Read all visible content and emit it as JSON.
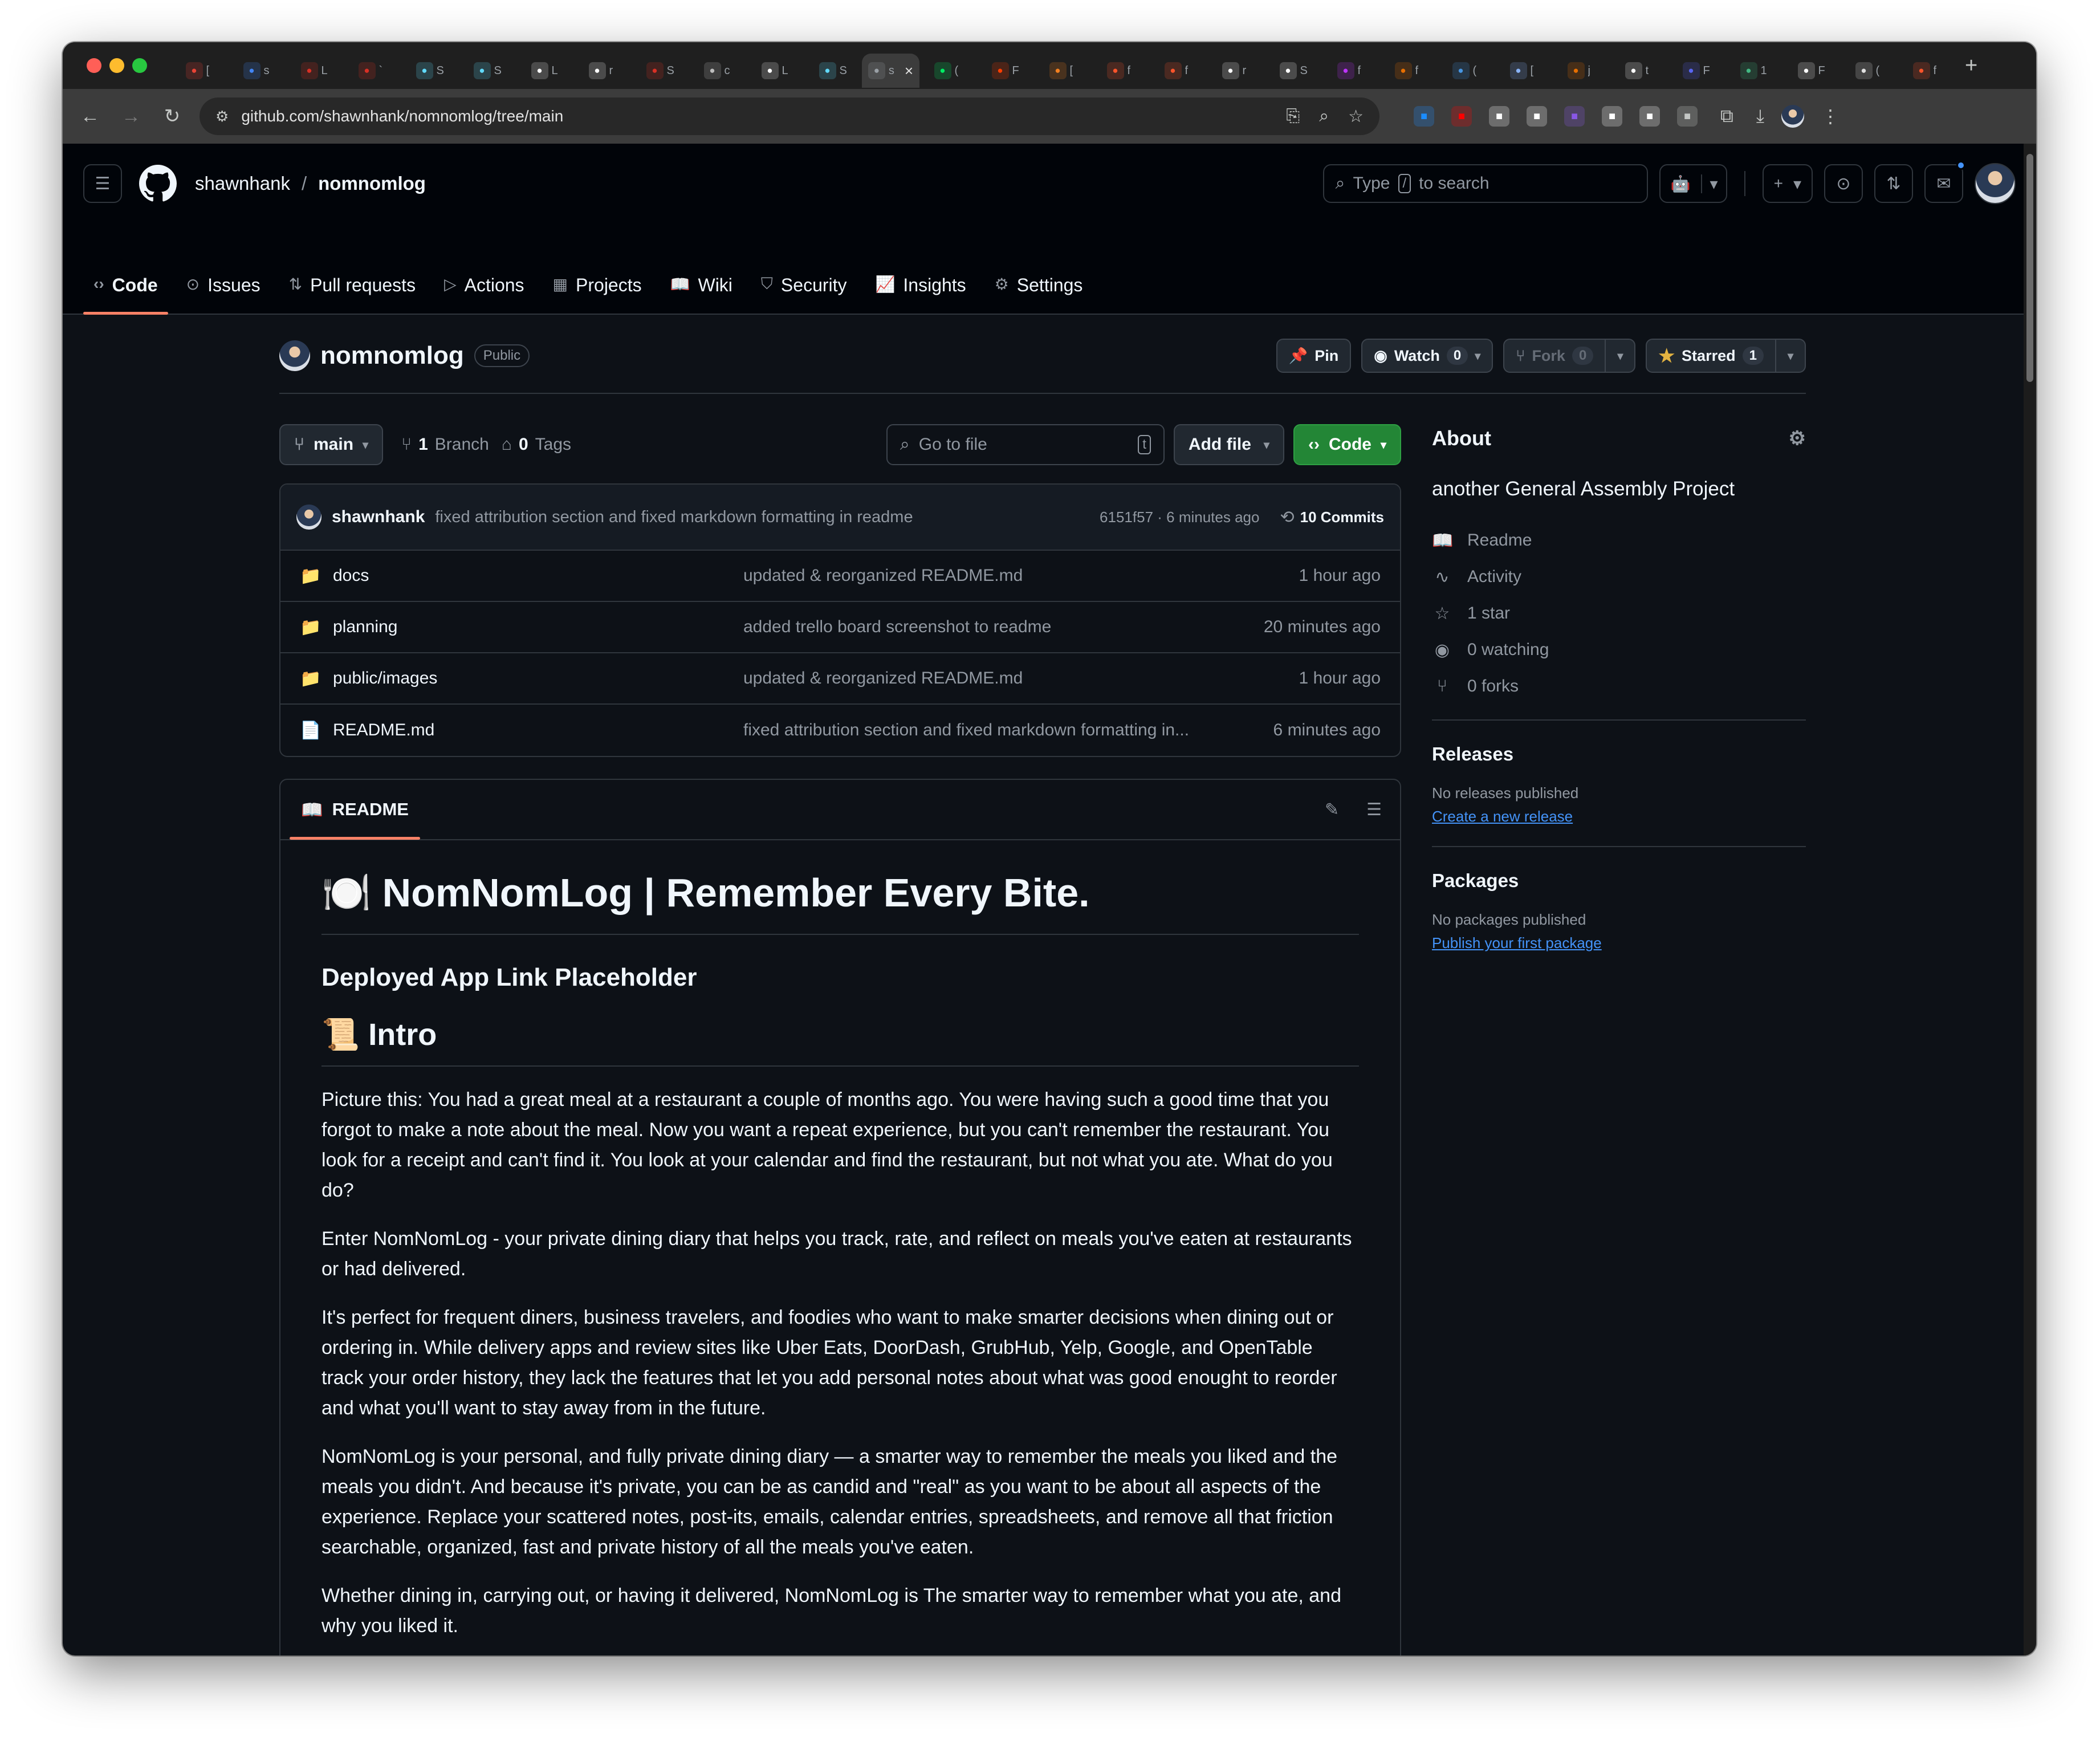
{
  "browser": {
    "tabs": [
      {
        "icon": "gmail-icon",
        "char": "[",
        "color": "#ea4335"
      },
      {
        "icon": "docs-icon",
        "char": "s",
        "color": "#4285f4"
      },
      {
        "icon": "red-b-icon",
        "char": "L",
        "color": "#d93025"
      },
      {
        "icon": "red-b-icon",
        "char": "`",
        "color": "#d93025"
      },
      {
        "icon": "react-icon",
        "char": "S",
        "color": "#61dafb"
      },
      {
        "icon": "react-icon",
        "char": "S",
        "color": "#61dafb"
      },
      {
        "icon": "medium-icon",
        "char": "L",
        "color": "#ffffff"
      },
      {
        "icon": "github-icon",
        "char": "r",
        "color": "#ffffff"
      },
      {
        "icon": "red-b-icon",
        "char": "S",
        "color": "#d93025"
      },
      {
        "icon": "chatgpt-icon",
        "char": "c",
        "color": "#bdbdbd"
      },
      {
        "icon": "medium-icon",
        "char": "L",
        "color": "#ffffff"
      },
      {
        "icon": "react-icon",
        "char": "S",
        "color": "#61dafb"
      },
      {
        "icon": "generic-icon",
        "char": "s",
        "color": "#9aa0a6",
        "active": true
      },
      {
        "icon": "mongodb-icon",
        "char": "(",
        "color": "#00ed64"
      },
      {
        "icon": "svelte-icon",
        "char": "F",
        "color": "#ff3e00"
      },
      {
        "icon": "cloudflare-icon",
        "char": "[",
        "color": "#f38020"
      },
      {
        "icon": "brave-icon",
        "char": "f",
        "color": "#fb542b"
      },
      {
        "icon": "brave-icon",
        "char": "f",
        "color": "#fb542b"
      },
      {
        "icon": "github-icon",
        "char": "r",
        "color": "#ffffff"
      },
      {
        "icon": "github-icon",
        "char": "S",
        "color": "#ffffff"
      },
      {
        "icon": "vite-icon",
        "char": "f",
        "color": "#bd34fe"
      },
      {
        "icon": "java-icon",
        "char": "f",
        "color": "#e76f00"
      },
      {
        "icon": "gemini-icon",
        "char": "(",
        "color": "#4796e3"
      },
      {
        "icon": "screen-icon",
        "char": "[",
        "color": "#8ab4f8"
      },
      {
        "icon": "java-icon",
        "char": "j",
        "color": "#e76f00"
      },
      {
        "icon": "google-icon",
        "char": "t",
        "color": "#ffffff"
      },
      {
        "icon": "discord-icon",
        "char": "F",
        "color": "#5865f2"
      },
      {
        "icon": "vue-icon",
        "char": "1",
        "color": "#42b883"
      },
      {
        "icon": "notion-icon",
        "char": "F",
        "color": "#ffffff"
      },
      {
        "icon": "trello-icon",
        "char": "(",
        "color": "#e0e0e0"
      },
      {
        "icon": "brave-icon",
        "char": "f",
        "color": "#fb542b"
      }
    ],
    "url": "github.com/shawnhank/nomnomlog/tree/main",
    "extensions": [
      {
        "icon": "onepassword-icon",
        "color": "#1a8cff"
      },
      {
        "icon": "youtube-icon",
        "color": "#ff0000"
      },
      {
        "icon": "hi-icon",
        "color": "#ffffff"
      },
      {
        "icon": "m-logo-icon",
        "color": "#ffffff"
      },
      {
        "icon": "purple-ext-icon",
        "color": "#8957e5"
      },
      {
        "icon": "instapaper-icon",
        "color": "#ffffff"
      },
      {
        "icon": "medium-ext-icon",
        "color": "#ffffff"
      },
      {
        "icon": "puzzle-icon",
        "color": "#c4c7c5"
      }
    ]
  },
  "github": {
    "owner": "shawnhank",
    "repo": "nomnomlog",
    "search_prefix": "Type",
    "search_key": "/",
    "search_suffix": "to search",
    "nav_tabs": [
      {
        "label": "Code",
        "icon": "code-icon",
        "glyph": "‹›"
      },
      {
        "label": "Issues",
        "icon": "issue-icon",
        "glyph": "⊙"
      },
      {
        "label": "Pull requests",
        "icon": "pull-request-icon",
        "glyph": "⇅"
      },
      {
        "label": "Actions",
        "icon": "play-icon",
        "glyph": "▷"
      },
      {
        "label": "Projects",
        "icon": "table-icon",
        "glyph": "▦"
      },
      {
        "label": "Wiki",
        "icon": "book-icon",
        "glyph": "📖"
      },
      {
        "label": "Security",
        "icon": "shield-icon",
        "glyph": "⛉"
      },
      {
        "label": "Insights",
        "icon": "graph-icon",
        "glyph": "📈"
      },
      {
        "label": "Settings",
        "icon": "gear-icon",
        "glyph": "⚙"
      }
    ]
  },
  "repo": {
    "name": "nomnomlog",
    "visibility": "Public",
    "pin_label": "Pin",
    "watch_label": "Watch",
    "watch_count": "0",
    "fork_label": "Fork",
    "fork_count": "0",
    "star_label": "Starred",
    "star_count": "1",
    "branch": "main",
    "branch_count": "1",
    "branch_label": "Branch",
    "tag_count": "0",
    "tag_label": "Tags",
    "goto_placeholder": "Go to file",
    "goto_key": "t",
    "add_file_label": "Add file",
    "code_label": "Code"
  },
  "latest_commit": {
    "author": "shawnhank",
    "message": "fixed attribution section and fixed markdown formatting in readme",
    "sha_time": "6151f57 · 6 minutes ago",
    "commits": "10 Commits"
  },
  "files": [
    {
      "type": "folder",
      "name": "docs",
      "message": "updated & reorganized README.md",
      "age": "1 hour ago"
    },
    {
      "type": "folder",
      "name": "planning",
      "message": "added trello board screenshot to readme",
      "age": "20 minutes ago"
    },
    {
      "type": "folder",
      "name": "public/images",
      "message": "updated & reorganized README.md",
      "age": "1 hour ago"
    },
    {
      "type": "file",
      "name": "README.md",
      "message": "fixed attribution section and fixed markdown formatting in...",
      "age": "6 minutes ago"
    }
  ],
  "readme": {
    "tab_label": "README",
    "h1": "🍽️ NomNomLog | Remember Every Bite.",
    "h3": "Deployed App Link Placeholder",
    "h2": "📜 Intro",
    "paragraphs": [
      "Picture this: You had a great meal at a restaurant a couple of months ago. You were having such a good time that you forgot to make a note about the meal. Now you want a repeat experience, but you can't remember the restaurant. You look for a receipt and can't find it. You look at your calendar and find the restaurant, but not what you ate. What do you do?",
      "Enter NomNomLog - your private dining diary that helps you track, rate, and reflect on meals you've eaten at restaurants or had delivered.",
      "It's perfect for frequent diners, business travelers, and foodies who want to make smarter decisions when dining out or ordering in. While delivery apps and review sites like Uber Eats, DoorDash, GrubHub, Yelp, Google, and OpenTable track your order history, they lack the features that let you add personal notes about what was good enought to reorder and what you'll want to stay away from in the future.",
      "NomNomLog is your personal, and fully private dining diary — a smarter way to remember the meals you liked and the meals you didn't. And because it's private, you can be as candid and \"real\" as you want to be about all aspects of the experience. Replace your scattered notes, post-its, emails, calendar entries, spreadsheets, and remove all that friction searchable, organized, fast and private history of all the meals you've eaten.",
      "Whether dining in, carrying out, or having it delivered, NomNomLog is The smarter way to remember what you ate, and why you liked it."
    ]
  },
  "about": {
    "title": "About",
    "description": "another General Assembly Project",
    "items": [
      {
        "icon": "book-icon",
        "glyph": "📖",
        "label": "Readme"
      },
      {
        "icon": "pulse-icon",
        "glyph": "∿",
        "label": "Activity"
      },
      {
        "icon": "star-icon",
        "glyph": "☆",
        "label": "1 star"
      },
      {
        "icon": "eye-icon",
        "glyph": "◉",
        "label": "0 watching"
      },
      {
        "icon": "fork-icon",
        "glyph": "⑂",
        "label": "0 forks"
      }
    ],
    "releases_title": "Releases",
    "releases_text": "No releases published",
    "releases_link": "Create a new release",
    "packages_title": "Packages",
    "packages_text": "No packages published",
    "packages_link": "Publish your first package"
  }
}
